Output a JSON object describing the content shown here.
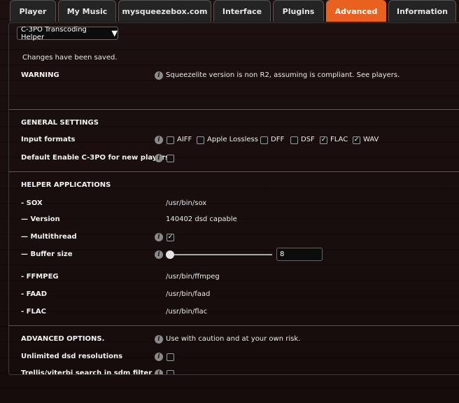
{
  "tabs": [
    {
      "label": "Player"
    },
    {
      "label": "My Music"
    },
    {
      "label": "mysqueezebox.com"
    },
    {
      "label": "Interface"
    },
    {
      "label": "Plugins"
    },
    {
      "label": "Advanced",
      "active": true
    },
    {
      "label": "Information"
    }
  ],
  "plugin_select": {
    "value": "C-3PO Transcoding Helper",
    "caret": "▼"
  },
  "saved_message": "Changes have been saved.",
  "warning": {
    "label": "WARNING",
    "text": "Squeezelite version is non R2, assuming is compliant. See players."
  },
  "general": {
    "heading": "GENERAL SETTINGS",
    "input_formats_label": "Input formats",
    "formats": [
      {
        "label": "AIFF",
        "checked": false
      },
      {
        "label": "Apple Lossless",
        "checked": false
      },
      {
        "label": "DFF",
        "checked": false
      },
      {
        "label": "DSF",
        "checked": false
      },
      {
        "label": "FLAC",
        "checked": true
      },
      {
        "label": "WAV",
        "checked": true
      }
    ],
    "default_enable_label": "Default Enable C-3PO for new players",
    "default_enable_checked": false
  },
  "helpers": {
    "heading": "HELPER APPLICATIONS",
    "sox_label": "- SOX",
    "sox_path": "/usr/bin/sox",
    "version_label": "— Version",
    "version_value": "140402 dsd capable",
    "multithread_label": "— Multithread",
    "multithread_checked": true,
    "buffer_label": "— Buffer size",
    "buffer_value": "8",
    "buffer_fraction": 0.0,
    "ffmpeg_label": "- FFMPEG",
    "ffmpeg_path": "/usr/bin/ffmpeg",
    "faad_label": "- FAAD",
    "faad_path": "/usr/bin/faad",
    "flac_label": "- FLAC",
    "flac_path": "/usr/bin/flac"
  },
  "advanced": {
    "heading": "ADVANCED OPTIONS.",
    "caution": "Use with caution and at your own risk.",
    "unlimited_dsd_label": "Unlimited dsd resolutions",
    "trellis_label": "Trellis/viterbi search in sdm filter"
  },
  "colors": {
    "accent": "#e8611e"
  }
}
